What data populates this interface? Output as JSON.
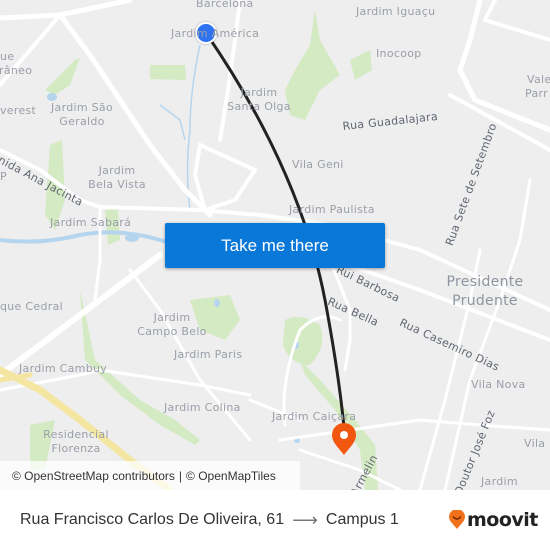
{
  "map": {
    "labels": {
      "barcelona": "Barcelona",
      "jardim_america": "Jardim América",
      "jardim_iguacu": "Jardim Iguaçu",
      "inocoop": "Inocoop",
      "vale_parr_1": "Vale",
      "vale_parr_2": "Parr",
      "ue": "ue",
      "raneo": "râneo",
      "everest": "verest",
      "jardim_sao_geraldo_1": "Jardim São",
      "jardim_sao_geraldo_2": "Geraldo",
      "jardim_santa_olga_1": "Jardim",
      "jardim_santa_olga_2": "Santa Olga",
      "rua_guadalajara": "Rua Guadalajara",
      "avenida_ana_jacinta": "enida Ana Jacinta",
      "p_left": "P",
      "jardim_bela_vista_1": "Jardim",
      "jardim_bela_vista_2": "Bela Vista",
      "vila_geni": "Vila Geni",
      "rua_sete_de_setembro": "Rua Sete de Setembro",
      "jardim_sabara": "Jardim Sabará",
      "jardim_paulista": "Jardim Paulista",
      "rui_barbosa": "Rui Barbosa",
      "presidente_prudente_1": "Presidente",
      "presidente_prudente_2": "Prudente",
      "que_cedral": "que Cedral",
      "rua_bella": "Rua Bella",
      "rua_casemiro_dias": "Rua Casemiro Dias",
      "jardim_campo_belo_1": "Jardim",
      "jardim_campo_belo_2": "Campo Belo",
      "jardim_paris": "Jardim Paris",
      "jardim_cambuy": "Jardim Cambuy",
      "vila_nova": "Vila Nova",
      "jardim_colina": "Jardim Colina",
      "jardim_caicara": "Jardim Caiçara",
      "residencial_florenza_1": "Residencial",
      "residencial_florenza_2": "Florenza",
      "armelin": "Armelin",
      "doutor_jose_foz": "Doutor José Foz",
      "vila_right": "Vila",
      "jardim_bottom_right": "Jardim"
    },
    "cta_label": "Take me there",
    "attribution": {
      "osm": "© OpenStreetMap contributors",
      "separator": "|",
      "omt": "© OpenMapTiles"
    },
    "colors": {
      "origin": "#2f72f0",
      "destination": "#f2570f",
      "route_line": "#222222",
      "cta_bg": "#0a78d8",
      "park": "#cfe8b8",
      "water": "#a9cfee",
      "highway": "#f5e7a1"
    }
  },
  "footer": {
    "origin": "Rua Francisco Carlos De Oliveira, 61",
    "arrow": "⟶",
    "destination": "Campus 1",
    "brand": "moovit"
  }
}
